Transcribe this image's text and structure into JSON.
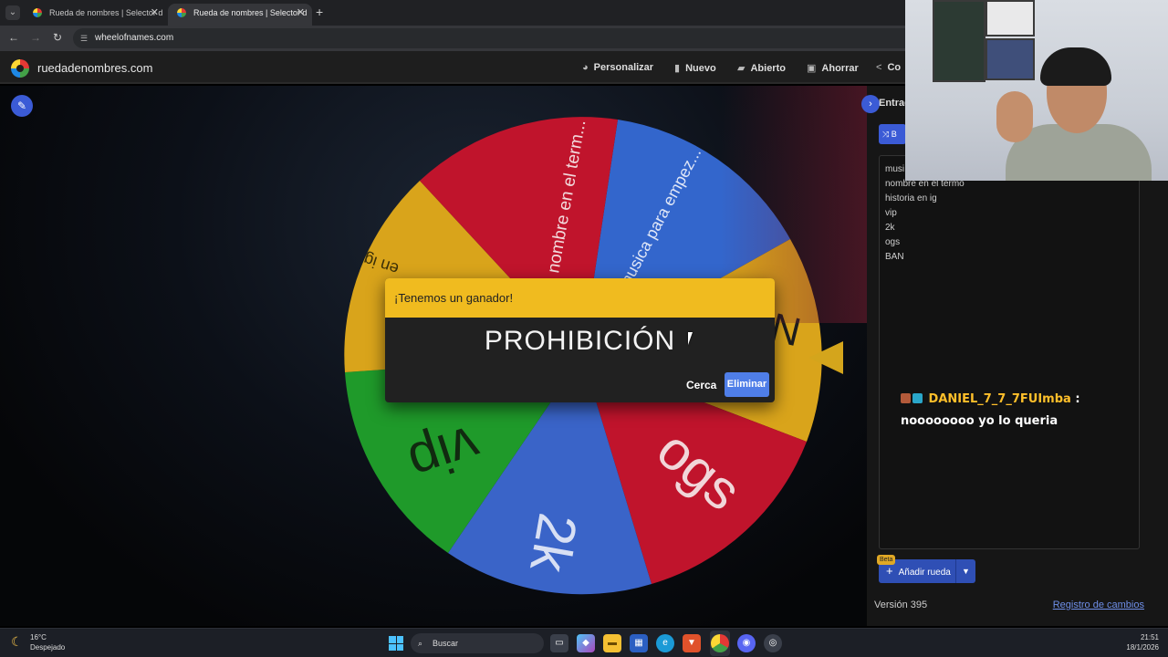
{
  "browser": {
    "tabs": [
      {
        "title": "Rueda de nombres | Selector d"
      },
      {
        "title": "Rueda de nombres | Selector d"
      }
    ],
    "url": "wheelofnames.com"
  },
  "site": {
    "name": "ruedadenombres.com",
    "menu": [
      {
        "label": "Personalizar",
        "icon": "palette-icon"
      },
      {
        "label": "Nuevo",
        "icon": "file-icon"
      },
      {
        "label": "Abierto",
        "icon": "folder-open-icon"
      },
      {
        "label": "Ahorrar",
        "icon": "save-icon"
      },
      {
        "label": "Co",
        "icon": "share-icon"
      }
    ]
  },
  "wheel": {
    "segments": [
      {
        "label": "musica para empez...",
        "color": "#3366cc"
      },
      {
        "label": "BAN",
        "color": "#d9a41b"
      },
      {
        "label": "ogs",
        "color": "#c0142c"
      },
      {
        "label": "2k",
        "color": "#3a64c8"
      },
      {
        "label": "vip",
        "color": "#1f9a2a"
      },
      {
        "label": "historia en ig",
        "color": "#d9a41b"
      },
      {
        "label": "nombre en el term...",
        "color": "#c0142c"
      }
    ],
    "visible_text": {
      "seg_top_red": "nombre en el term...",
      "seg_top_blue": "musica para empez...",
      "seg_left_yellow": "en ig",
      "seg_right_yellow": "N",
      "seg_ogs": "ogs",
      "seg_2k": "2k",
      "seg_vip": "vip"
    }
  },
  "dialog": {
    "title": "¡Tenemos un ganador!",
    "winner": "PROHIBICIÓN",
    "close_label": "Cerca",
    "remove_label": "Eliminar"
  },
  "panel": {
    "tab_label": "Entrad",
    "shuffle_label": "B",
    "entries": [
      "musi",
      "nombre en el termo",
      "historia en ig",
      "vip",
      "2k",
      "ogs",
      "BAN"
    ],
    "beta_label": "Beta",
    "add_wheel_label": "Añadir rueda",
    "version": "Versión 395",
    "changelog": "Registro de cambios"
  },
  "chat": {
    "user": "DANIEL_7_7_7FUImba",
    "separator": ":",
    "message": "noooooooo yo lo queria"
  },
  "taskbar": {
    "temp": "16°C",
    "weather": "Despejado",
    "search_placeholder": "Buscar",
    "time": "21:51",
    "date": "18/1/2026"
  }
}
